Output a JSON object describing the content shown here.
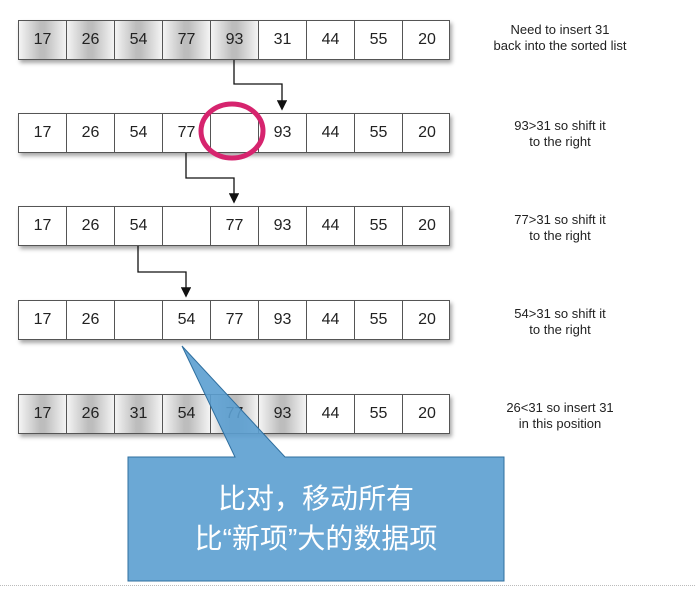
{
  "rows": [
    {
      "cells": [
        "17",
        "26",
        "54",
        "77",
        "93",
        "31",
        "44",
        "55",
        "20"
      ],
      "note": [
        "Need to insert 31",
        "back into the sorted list"
      ]
    },
    {
      "cells": [
        "17",
        "26",
        "54",
        "77",
        "",
        "93",
        "44",
        "55",
        "20"
      ],
      "note": [
        "93>31 so shift it",
        "to the right"
      ]
    },
    {
      "cells": [
        "17",
        "26",
        "54",
        "",
        "77",
        "93",
        "44",
        "55",
        "20"
      ],
      "note": [
        "77>31 so shift it",
        "to the right"
      ]
    },
    {
      "cells": [
        "17",
        "26",
        "",
        "54",
        "77",
        "93",
        "44",
        "55",
        "20"
      ],
      "note": [
        "54>31 so shift it",
        "to the right"
      ]
    },
    {
      "cells": [
        "17",
        "26",
        "31",
        "54",
        "77",
        "93",
        "44",
        "55",
        "20"
      ],
      "note": [
        "26<31 so insert 31",
        "in this position"
      ]
    }
  ],
  "callout": {
    "line1": "比对，移动所有",
    "line2": "比“新项”大的数据项"
  },
  "colors": {
    "callout_fill": "#5b9fd0",
    "highlight_circle": "#d6246e",
    "cell_border": "#555555"
  }
}
